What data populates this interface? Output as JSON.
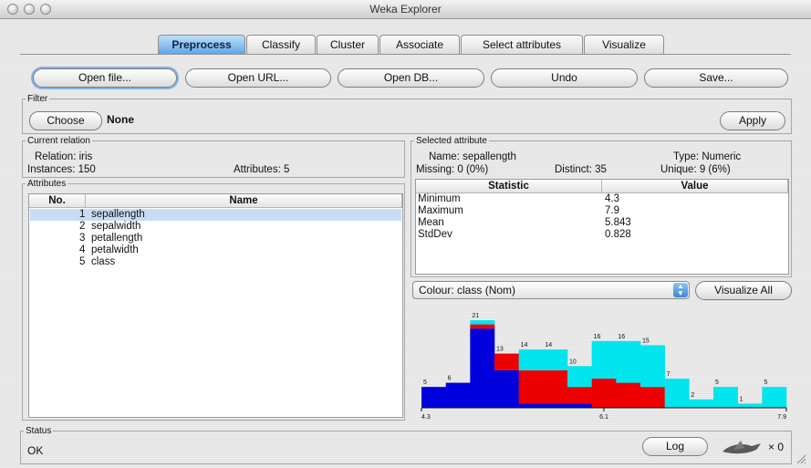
{
  "window": {
    "title": "Weka Explorer"
  },
  "tabs": [
    "Preprocess",
    "Classify",
    "Cluster",
    "Associate",
    "Select attributes",
    "Visualize"
  ],
  "toolbar": {
    "open_file": "Open file...",
    "open_url": "Open URL...",
    "open_db": "Open DB...",
    "undo": "Undo",
    "save": "Save..."
  },
  "filter": {
    "legend": "Filter",
    "choose": "Choose",
    "value": "None",
    "apply": "Apply"
  },
  "relation": {
    "legend": "Current relation",
    "relation": "Relation: iris",
    "instances": "Instances: 150",
    "attributes": "Attributes: 5"
  },
  "attributes": {
    "legend": "Attributes",
    "col_no": "No.",
    "col_name": "Name",
    "rows": [
      {
        "no": "1",
        "name": "sepallength"
      },
      {
        "no": "2",
        "name": "sepalwidth"
      },
      {
        "no": "3",
        "name": "petallength"
      },
      {
        "no": "4",
        "name": "petalwidth"
      },
      {
        "no": "5",
        "name": "class"
      }
    ]
  },
  "selected": {
    "legend": "Selected attribute",
    "name": "Name: sepallength",
    "type": "Type: Numeric",
    "missing": "Missing: 0 (0%)",
    "distinct": "Distinct: 35",
    "unique": "Unique: 9 (6%)",
    "col_statistic": "Statistic",
    "col_value": "Value",
    "stats": [
      {
        "stat": "Minimum",
        "value": "4.3"
      },
      {
        "stat": "Maximum",
        "value": "7.9"
      },
      {
        "stat": "Mean",
        "value": "5.843"
      },
      {
        "stat": "StdDev",
        "value": "0.828"
      }
    ]
  },
  "colour": {
    "selected": "Colour: class (Nom)",
    "visualize_all": "Visualize All"
  },
  "histogram": {
    "colors": {
      "setosa": "#0000dd",
      "versicolor": "#ee0000",
      "virginica": "#00e5ee"
    },
    "counts": [
      5,
      6,
      21,
      13,
      14,
      14,
      10,
      16,
      16,
      15,
      7,
      2,
      5,
      1,
      5
    ],
    "tick_labels": [
      "4.3",
      "6.1",
      "7.9"
    ]
  },
  "chart_data": {
    "type": "bar",
    "x": [
      4.42,
      4.66,
      4.9,
      5.14,
      5.38,
      5.62,
      5.86,
      6.1,
      6.34,
      6.58,
      6.82,
      7.06,
      7.3,
      7.54,
      7.78
    ],
    "categories": [
      "4.3",
      "",
      "",
      "",
      "",
      "",
      "",
      "6.1",
      "",
      "",
      "",
      "",
      "",
      "",
      "7.9"
    ],
    "series": [
      {
        "name": "",
        "values": [
          5,
          6,
          19,
          9,
          1,
          1,
          1,
          0,
          0,
          0,
          0,
          0,
          0,
          0,
          0
        ]
      },
      {
        "name": "",
        "values": [
          0,
          0,
          1,
          4,
          8,
          8,
          4,
          7,
          6,
          5,
          0,
          0,
          0,
          0,
          0
        ]
      },
      {
        "name": "",
        "values": [
          0,
          0,
          1,
          0,
          5,
          5,
          5,
          9,
          10,
          10,
          7,
          2,
          5,
          1,
          5
        ]
      }
    ],
    "totals": [
      5,
      6,
      21,
      13,
      14,
      14,
      10,
      16,
      16,
      15,
      7,
      2,
      5,
      1,
      5
    ],
    "xlim": [
      4.3,
      7.9
    ],
    "ylim": [
      0,
      21
    ],
    "stacked": true,
    "grid": false
  },
  "status": {
    "legend": "Status",
    "text": "OK",
    "log": "Log",
    "count": "× 0"
  }
}
